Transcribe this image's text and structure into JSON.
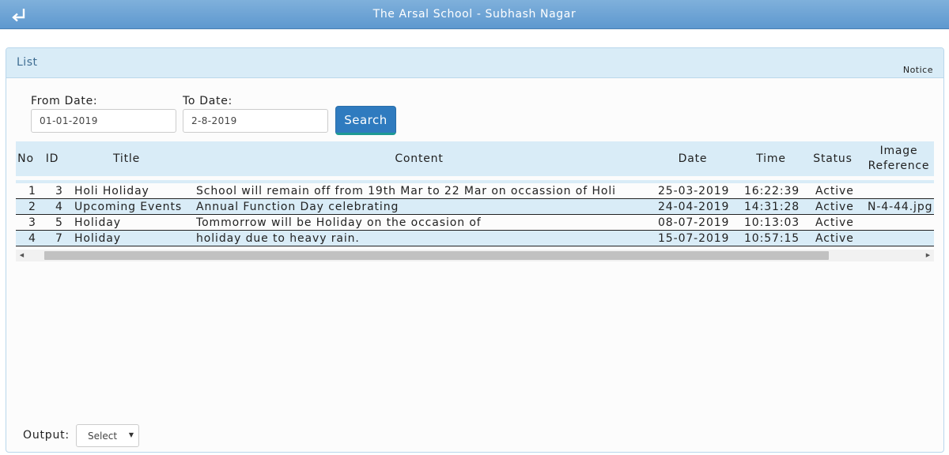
{
  "header": {
    "title": "The Arsal School - Subhash Nagar",
    "back_icon": "return-arrow-icon"
  },
  "panel": {
    "title": "List",
    "notice": "Notice"
  },
  "filters": {
    "from_label": "From Date:",
    "from_value": "01-01-2019",
    "to_label": "To Date:",
    "to_value": "2-8-2019",
    "search_label": "Search"
  },
  "table": {
    "columns": [
      "No",
      "ID",
      "Title",
      "Content",
      "Date",
      "Time",
      "Status",
      "Image Reference"
    ],
    "rows": [
      [
        "1",
        "3",
        "Holi Holiday",
        "School will remain off from 19th Mar to 22 Mar on occassion of Holi",
        "25-03-2019",
        "16:22:39",
        "Active",
        ""
      ],
      [
        "2",
        "4",
        "Upcoming Events",
        "Annual Function Day celebrating",
        "24-04-2019",
        "14:31:28",
        "Active",
        "N-4-44.jpg"
      ],
      [
        "3",
        "5",
        "Holiday",
        "Tommorrow will be Holiday on the occasion of",
        "08-07-2019",
        "10:13:03",
        "Active",
        ""
      ],
      [
        "4",
        "7",
        "Holiday",
        "holiday due to heavy rain.",
        "15-07-2019",
        "10:57:15",
        "Active",
        ""
      ]
    ]
  },
  "scrollbar": {
    "left_arrow": "◀",
    "right_arrow": "▶"
  },
  "output": {
    "label": "Output:",
    "selected": "Select",
    "caret": "▼"
  },
  "colors": {
    "header_bar": "#6aa3d6",
    "panel_head": "#d9ecf7",
    "button": "#2f7bbf",
    "row_alt": "#d9ecf7"
  }
}
